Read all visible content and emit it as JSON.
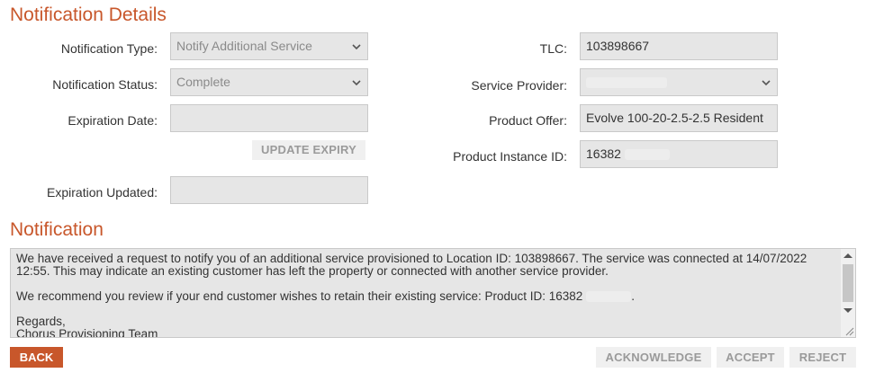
{
  "details": {
    "title": "Notification Details",
    "notification_type": {
      "label": "Notification Type:",
      "value": "Notify Additional Service"
    },
    "notification_status": {
      "label": "Notification Status:",
      "value": "Complete"
    },
    "expiration_date": {
      "label": "Expiration Date:",
      "value": ""
    },
    "update_expiry_label": "UPDATE EXPIRY",
    "expiration_updated": {
      "label": "Expiration Updated:",
      "value": ""
    },
    "tlc": {
      "label": "TLC:",
      "value": "103898667"
    },
    "service_provider": {
      "label": "Service Provider:",
      "value": ""
    },
    "product_offer": {
      "label": "Product Offer:",
      "value": "Evolve 100-20-2.5-2.5 Resident"
    },
    "product_instance_id": {
      "label": "Product Instance ID:",
      "value": "16382"
    }
  },
  "notification": {
    "title": "Notification",
    "line1": "We have received a request to notify you of an additional service provisioned to Location ID: 103898667. The service was connected at 14/07/2022 12:55.  This may indicate an existing customer has left the property or connected with another service provider.",
    "line2": "We recommend you review if your end customer wishes to retain their existing service: Product ID: 16382",
    "line3": "Regards,",
    "line4": "Chorus Provisioning Team"
  },
  "actions": {
    "back": "BACK",
    "acknowledge": "ACKNOWLEDGE",
    "accept": "ACCEPT",
    "reject": "REJECT"
  },
  "colors": {
    "accent": "#c8572b",
    "field_bg": "#e6e6e6"
  },
  "icons": [
    "chevron-down-icon",
    "scroll-up-icon",
    "scroll-down-icon",
    "resize-grip-icon"
  ]
}
